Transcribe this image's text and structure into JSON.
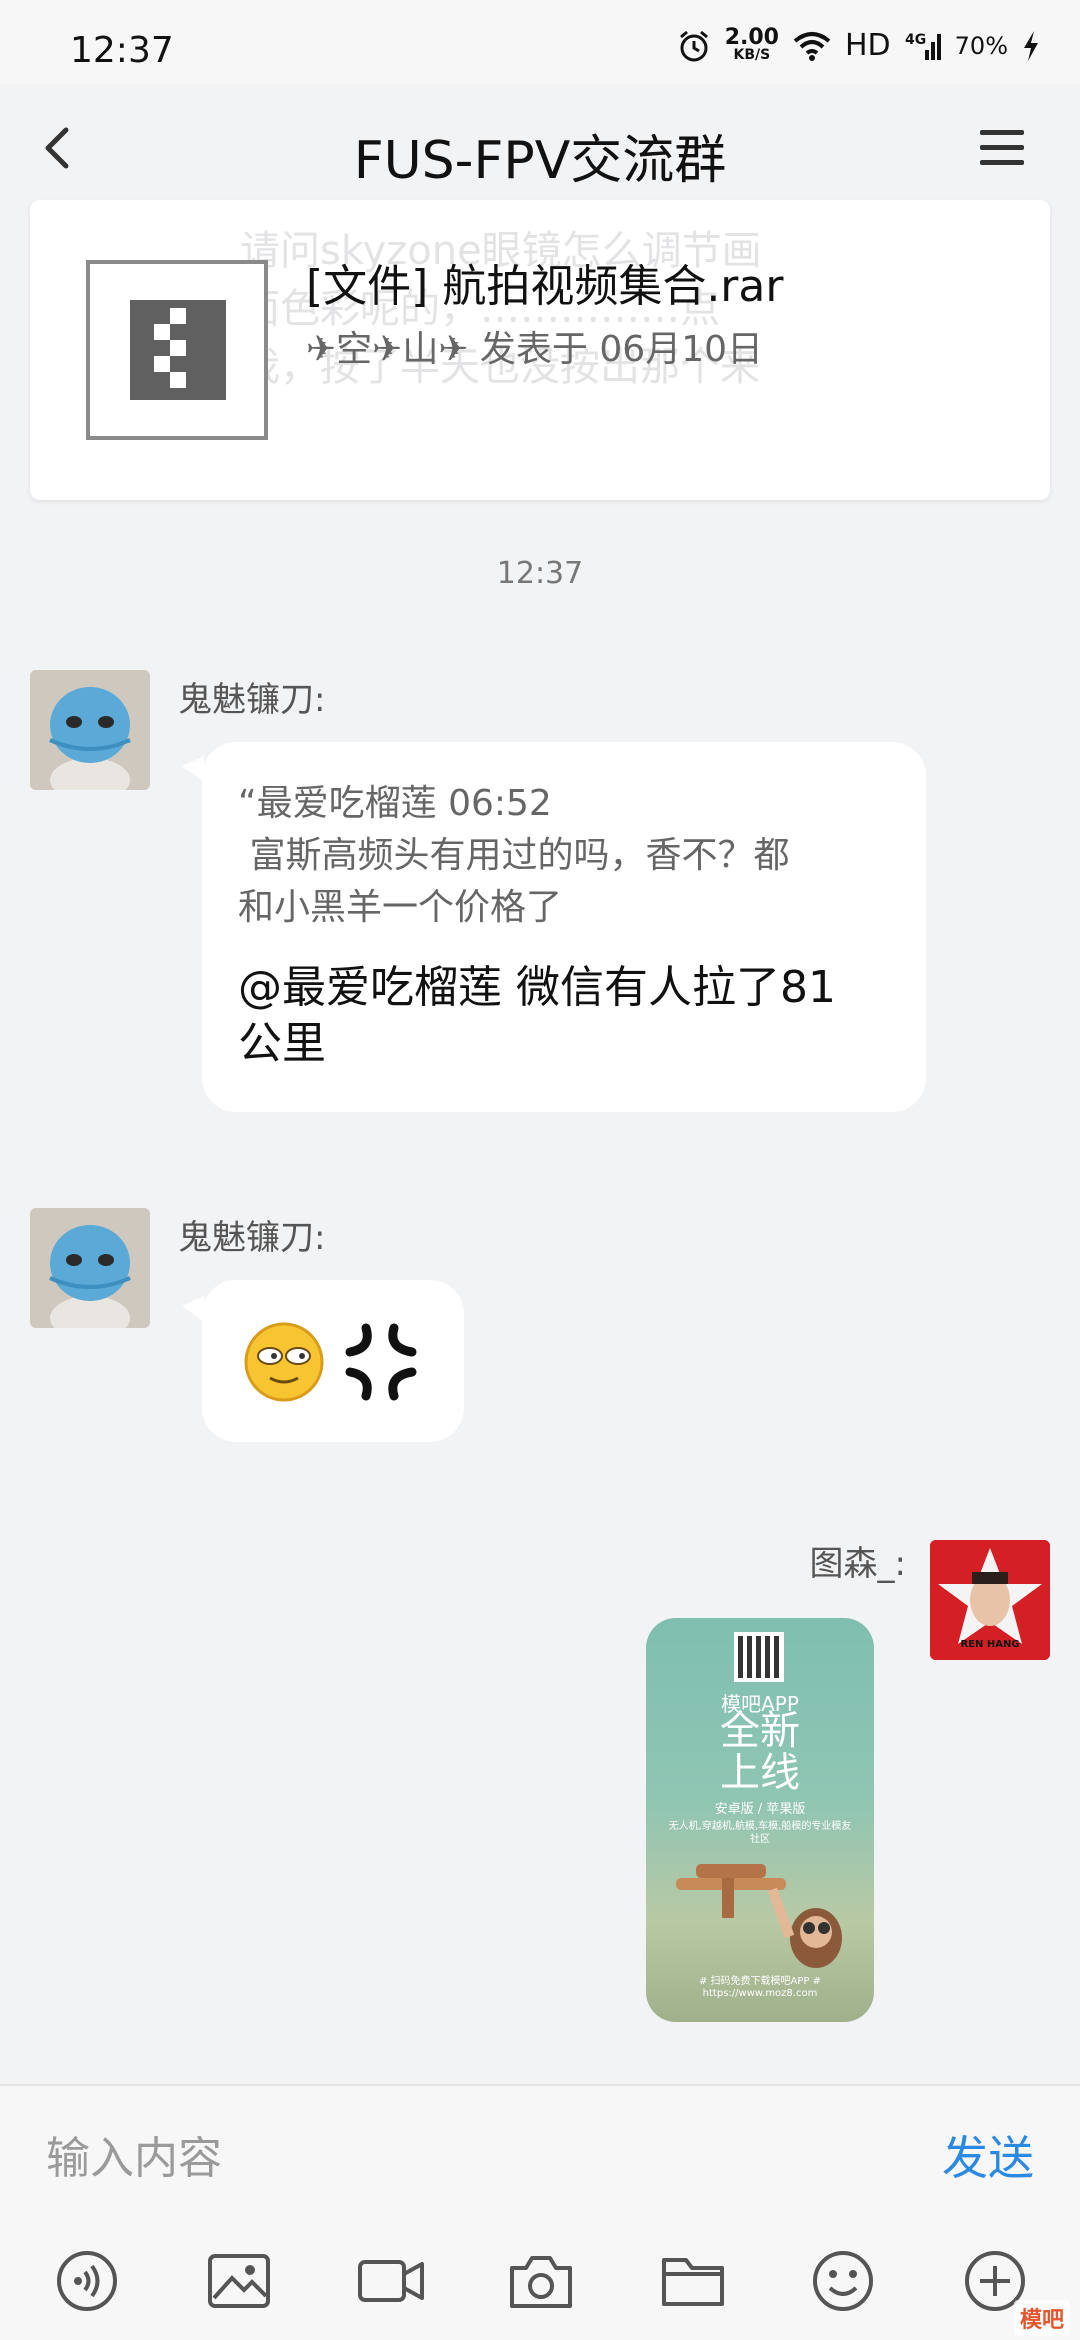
{
  "status": {
    "time": "12:37",
    "net_speed_value": "2.00",
    "net_speed_unit": "KB/S",
    "hd": "HD",
    "network": "4G",
    "battery": "70%"
  },
  "nav": {
    "title": "FUS-FPV交流群"
  },
  "file_card": {
    "ghost_line1": "请问skyzone眼镜怎么调节画",
    "ghost_line2": "面色彩呢的，……………点",
    "ghost_line3": "我，按了半天也没按出那个来",
    "file_name": "[文件] 航拍视频集合.rar",
    "meta": "✈空✈山✈ 发表于 06月10日"
  },
  "timestamp": "12:37",
  "messages": [
    {
      "sender": "鬼魅镰刀:",
      "quote_line1": "“最爱吃榴莲 06:52",
      "quote_line2": " 富斯高频头有用过的吗，香不？都",
      "quote_line3": "和小黑羊一个价格了",
      "reply_line1": "@最爱吃榴莲 微信有人拉了81",
      "reply_line2": "公里"
    },
    {
      "sender": "鬼魅镰刀:",
      "emoji1": "sweat-smile-emoji",
      "emoji2": "anger-symbol-emoji"
    }
  ],
  "sent": {
    "sender": "图森_:",
    "avatar_caption": "REN HANG",
    "poster": {
      "app": "模吧APP",
      "headline1": "全新",
      "headline2": "上线",
      "platform": "安卓版 / 苹果版",
      "desc": "无人机,穿越机,航模,车模,船模的专业模友社区",
      "footer": "# 扫码免费下载模吧APP #",
      "url": "https://www.moz8.com"
    }
  },
  "input": {
    "placeholder": "输入内容",
    "send_label": "发送"
  },
  "watermark": "模吧",
  "colors": {
    "background": "#f2f3f5",
    "bubble": "#ffffff",
    "send_blue": "#2a8ae2",
    "avatar_red": "#d41f24"
  }
}
